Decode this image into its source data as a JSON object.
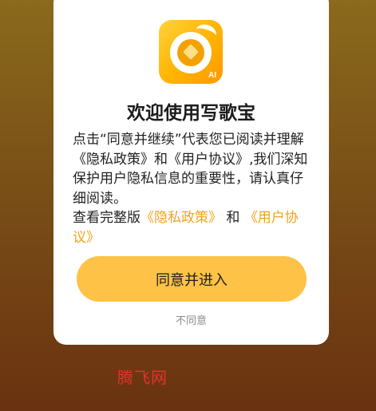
{
  "dialog": {
    "title": "欢迎使用写歌宝",
    "app_icon_badge": "AI",
    "message": {
      "intro": "点击“同意并继续”代表您已阅读并理解",
      "privacy_policy_inline": "《隐私政策》",
      "and_inline": "和",
      "user_agreement_inline": "《用户协议》",
      "rest": ",我们深知保护用户隐私信息的重要性，请认真仔细阅读。"
    },
    "view_full_prefix": "查看完整版",
    "privacy_policy_link": "《隐私政策》",
    "and_text": " 和 ",
    "user_agreement_link": "《用户协议》",
    "agree_button": "同意并进入",
    "disagree_link": "不同意"
  },
  "watermark": "腾飞网",
  "colors": {
    "accent": "#fdc246",
    "link": "#f2a21a",
    "watermark": "#e3322d"
  }
}
